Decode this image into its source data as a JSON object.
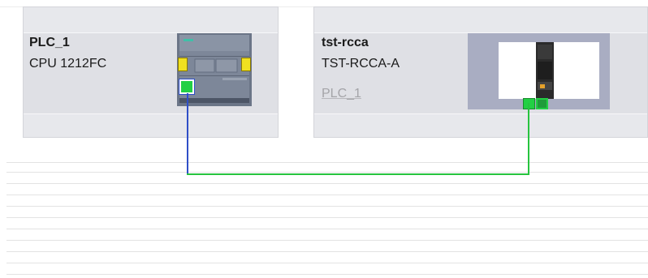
{
  "devices": [
    {
      "name": "PLC_1",
      "type": "CPU 1212FC",
      "icon": "plc-module-icon"
    },
    {
      "name": "tst-rcca",
      "type": "TST-RCCA-A",
      "assigned_controller": "PLC_1",
      "icon": "io-device-icon"
    }
  ],
  "connections": [
    {
      "from": "PLC_1",
      "to": "tst-rcca",
      "colors": {
        "controller_segment": "#2f4fc8",
        "device_segment": "#27c43f"
      }
    }
  ],
  "colors": {
    "port_green": "#22d044",
    "module_yellow": "#f0e020",
    "box_background": "#dfe0e5",
    "device_image_frame": "#a9adc2"
  }
}
